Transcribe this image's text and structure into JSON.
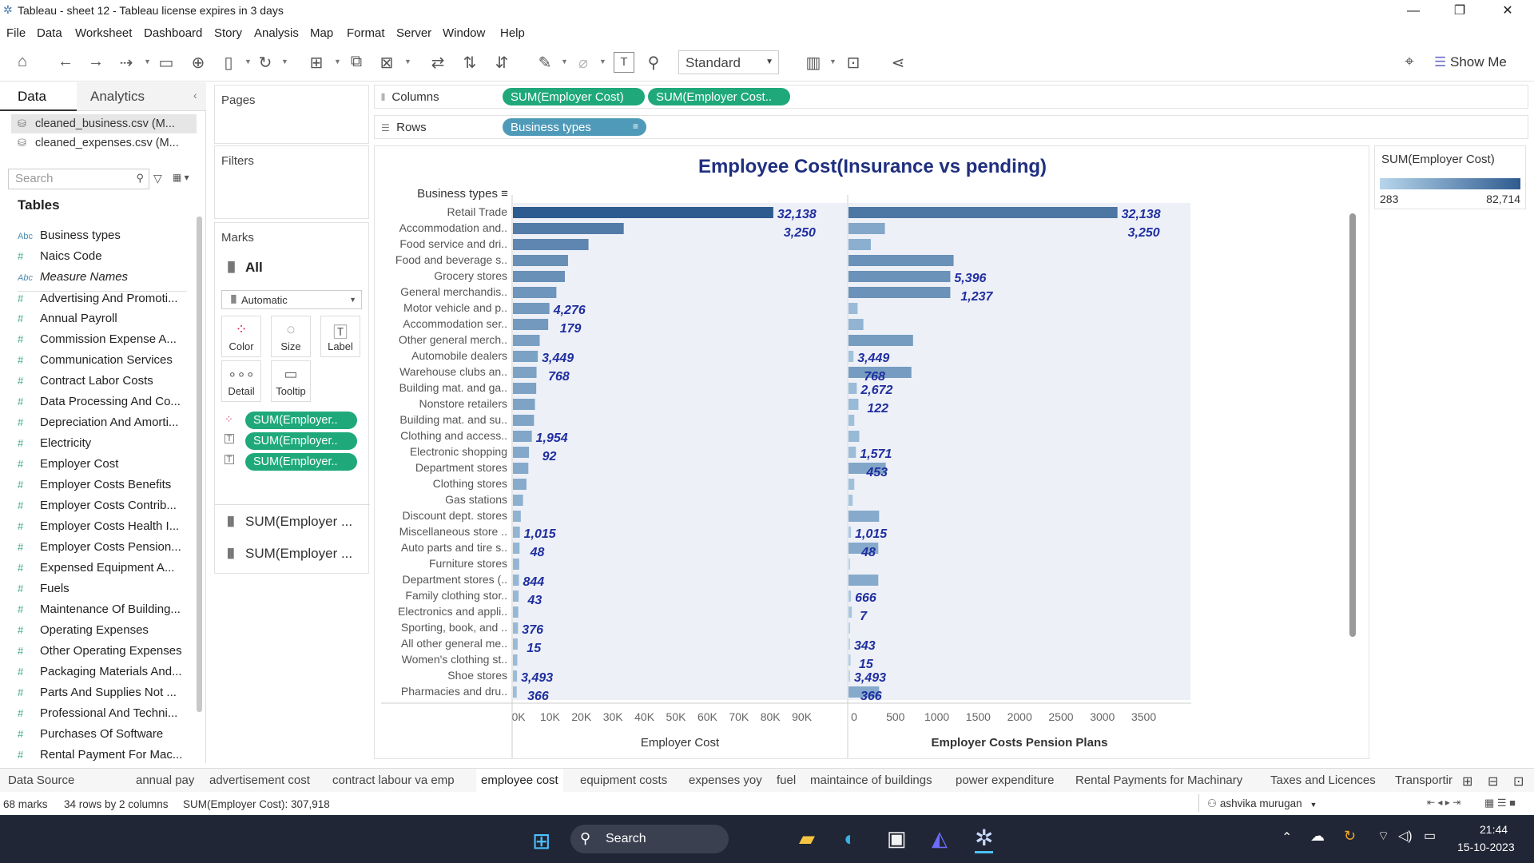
{
  "window": {
    "title": "Tableau - sheet 12 - Tableau license expires in 3 days"
  },
  "menu": [
    "File",
    "Data",
    "Worksheet",
    "Dashboard",
    "Story",
    "Analysis",
    "Map",
    "Format",
    "Server",
    "Window",
    "Help"
  ],
  "toolbar": {
    "fit": "Standard",
    "show_me": "Show Me"
  },
  "data_pane": {
    "tab_data": "Data",
    "tab_analytics": "Analytics",
    "sources": [
      "cleaned_business.csv (M...",
      "cleaned_expenses.csv (M..."
    ],
    "search_placeholder": "Search",
    "tables_title": "Tables",
    "fields": [
      {
        "type": "Abc",
        "name": "Business types",
        "italic": false
      },
      {
        "type": "#",
        "name": "Naics Code",
        "italic": false
      },
      {
        "type": "Abc",
        "name": "Measure Names",
        "italic": true
      },
      {
        "type": "#",
        "name": "Advertising And Promoti...",
        "italic": false
      },
      {
        "type": "#",
        "name": "Annual Payroll",
        "italic": false
      },
      {
        "type": "#",
        "name": "Commission Expense A...",
        "italic": false
      },
      {
        "type": "#",
        "name": "Communication Services",
        "italic": false
      },
      {
        "type": "#",
        "name": "Contract Labor Costs",
        "italic": false
      },
      {
        "type": "#",
        "name": "Data Processing And Co...",
        "italic": false
      },
      {
        "type": "#",
        "name": "Depreciation And Amorti...",
        "italic": false
      },
      {
        "type": "#",
        "name": "Electricity",
        "italic": false
      },
      {
        "type": "#",
        "name": "Employer Cost",
        "italic": false
      },
      {
        "type": "#",
        "name": "Employer Costs Benefits",
        "italic": false
      },
      {
        "type": "#",
        "name": "Employer Costs Contrib...",
        "italic": false
      },
      {
        "type": "#",
        "name": "Employer Costs Health I...",
        "italic": false
      },
      {
        "type": "#",
        "name": "Employer Costs Pension...",
        "italic": false
      },
      {
        "type": "#",
        "name": "Expensed Equipment A...",
        "italic": false
      },
      {
        "type": "#",
        "name": "Fuels",
        "italic": false
      },
      {
        "type": "#",
        "name": "Maintenance Of Building...",
        "italic": false
      },
      {
        "type": "#",
        "name": "Operating Expenses",
        "italic": false
      },
      {
        "type": "#",
        "name": "Other Operating Expenses",
        "italic": false
      },
      {
        "type": "#",
        "name": "Packaging Materials And...",
        "italic": false
      },
      {
        "type": "#",
        "name": "Parts And Supplies Not ...",
        "italic": false
      },
      {
        "type": "#",
        "name": "Professional And Techni...",
        "italic": false
      },
      {
        "type": "#",
        "name": "Purchases Of Software",
        "italic": false
      },
      {
        "type": "#",
        "name": "Rental Payment For Mac...",
        "italic": false
      }
    ]
  },
  "cards": {
    "pages": "Pages",
    "filters": "Filters",
    "marks": "Marks",
    "all": "All",
    "mark_type": "Automatic",
    "color": "Color",
    "size": "Size",
    "label": "Label",
    "detail": "Detail",
    "tooltip": "Tooltip",
    "mark_pills": [
      "SUM(Employer..",
      "SUM(Employer..",
      "SUM(Employer.."
    ],
    "measure_rows": [
      "SUM(Employer ...",
      "SUM(Employer ..."
    ]
  },
  "shelves": {
    "columns_label": "Columns",
    "rows_label": "Rows",
    "columns": [
      "SUM(Employer Cost)",
      "SUM(Employer Cost.."
    ],
    "rows": [
      "Business types"
    ]
  },
  "legend": {
    "title": "SUM(Employer Cost)",
    "min": "283",
    "max": "82,714"
  },
  "chart_data": {
    "type": "bar",
    "title": "Employee Cost(Insurance vs pending)",
    "row_header": "Business types",
    "categories": [
      "Retail Trade",
      "Accommodation and..",
      "Food service and dri..",
      "Food and beverage s..",
      "Grocery stores",
      "General merchandis..",
      "Motor vehicle and p..",
      "Accommodation ser..",
      "Other general merch..",
      "Automobile dealers",
      "Warehouse clubs an..",
      "Building mat. and ga..",
      "Nonstore retailers",
      "Building mat. and su..",
      "Clothing and access..",
      "Electronic shopping",
      "Department stores",
      "Clothing stores",
      "Gas stations",
      "Discount dept. stores",
      "Miscellaneous store ..",
      "Auto parts and tire s..",
      "Furniture stores",
      "Department stores (..",
      "Family clothing stor..",
      "Electronics and appli..",
      "Sporting, book, and ..",
      "All other general me..",
      "Women's clothing st..",
      "Shoe stores",
      "Pharmacies and dru.."
    ],
    "series": [
      {
        "name": "Employer Cost",
        "xlabel": "Employer Cost",
        "ticks": [
          "0K",
          "10K",
          "20K",
          "30K",
          "40K",
          "50K",
          "60K",
          "70K",
          "80K",
          "90K"
        ],
        "xlim": [
          0,
          100000
        ],
        "values": [
          82714,
          35200,
          24000,
          17500,
          16500,
          13800,
          11600,
          11200,
          8500,
          7900,
          7500,
          7400,
          7000,
          6700,
          6000,
          5100,
          4900,
          4300,
          3200,
          2500,
          2200,
          2100,
          2000,
          1900,
          1800,
          1700,
          1600,
          1500,
          1400,
          1300,
          1200
        ]
      },
      {
        "name": "Employer Costs Pension Plans",
        "xlabel": "Employer Costs Pension Plans",
        "ticks": [
          "0",
          "500",
          "1000",
          "1500",
          "2000",
          "2500",
          "3000",
          "3500"
        ],
        "xlim": [
          0,
          3900
        ],
        "values": [
          3250,
          440,
          270,
          1270,
          1230,
          1230,
          110,
          180,
          780,
          60,
          760,
          100,
          120,
          70,
          130,
          90,
          450,
          70,
          50,
          370,
          30,
          360,
          20,
          360,
          30,
          40,
          20,
          15,
          25,
          12,
          370
        ]
      }
    ],
    "labels_left": [
      {
        "row": 0,
        "a": "32,138",
        "b": "3,250"
      },
      {
        "row": 6,
        "a": "4,276",
        "b": "179"
      },
      {
        "row": 9,
        "a": "3,449",
        "b": "768"
      },
      {
        "row": 14,
        "a": "1,954",
        "b": "92"
      },
      {
        "row": 20,
        "a": "1,015",
        "b": "48"
      },
      {
        "row": 23,
        "a": "844",
        "b": "43"
      },
      {
        "row": 26,
        "a": "376",
        "b": "15"
      },
      {
        "row": 29,
        "a": "3,493",
        "b": "366"
      }
    ],
    "labels_right": [
      {
        "row": 0,
        "a": "32,138",
        "b": "3,250"
      },
      {
        "row": 4,
        "a": "5,396",
        "b": "1,237"
      },
      {
        "row": 9,
        "a": "3,449",
        "b": "768"
      },
      {
        "row": 11,
        "a": "2,672",
        "b": "122"
      },
      {
        "row": 15,
        "a": "1,571",
        "b": "453"
      },
      {
        "row": 20,
        "a": "1,015",
        "b": "48"
      },
      {
        "row": 24,
        "a": "666",
        "b": "7"
      },
      {
        "row": 27,
        "a": "343",
        "b": "15"
      },
      {
        "row": 29,
        "a": "3,493",
        "b": "366"
      }
    ],
    "color_min": 283,
    "color_max": 82714
  },
  "sheet_tabs": [
    "Data Source",
    "annual pay",
    "advertisement cost",
    "contract labour va emp",
    "employee cost",
    "equipment costs",
    "expenses yoy",
    "fuel",
    "maintaince of buildings",
    "power expenditure",
    "Rental Payments for Machinary",
    "Taxes and Licences",
    "Transportir"
  ],
  "active_tab": "employee cost",
  "status": {
    "marks": "68 marks",
    "dims": "34 rows by 2 columns",
    "sum": "SUM(Employer Cost): 307,918",
    "user": "ashvika murugan"
  },
  "taskbar": {
    "search": "Search",
    "time": "21:44",
    "date": "15-10-2023"
  }
}
